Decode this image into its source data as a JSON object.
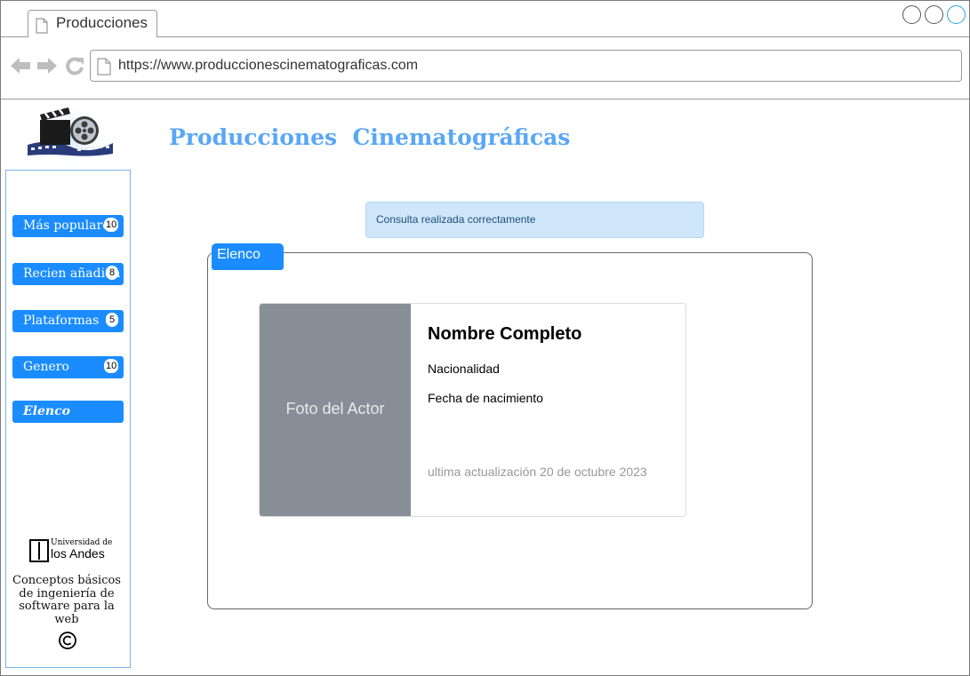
{
  "browser": {
    "tab_title": "Producciones",
    "url": "https://www.produccionescinematograficas.com"
  },
  "header": {
    "title": "Producciones  Cinematográficas"
  },
  "sidebar": {
    "items": [
      {
        "label": "Más populares",
        "badge": "10"
      },
      {
        "label": "Recien añadida",
        "badge": "8"
      },
      {
        "label": "Plataformas",
        "badge": "5"
      },
      {
        "label": "Genero",
        "badge": "10"
      },
      {
        "label": "Elenco",
        "badge": null
      }
    ],
    "active_item": "Elenco",
    "university_line1": "Universidad de",
    "university_line2": "los Andes",
    "note": "Conceptos básicos de ingeniería de software para la web"
  },
  "alert": {
    "text": "Consulta realizada correctamente"
  },
  "panel": {
    "legend": "Elenco",
    "card": {
      "photo_placeholder": "Foto del Actor",
      "name": "Nombre Completo",
      "nationality": "Nacionalidad",
      "birth_date": "Fecha de nacimiento",
      "updated": "ultima actualización 20 de octubre 2023"
    }
  },
  "colors": {
    "accent": "#1a8cff",
    "title": "#5aa7f5",
    "alert_bg": "#cfe6fb",
    "photo_bg": "#878e96"
  }
}
